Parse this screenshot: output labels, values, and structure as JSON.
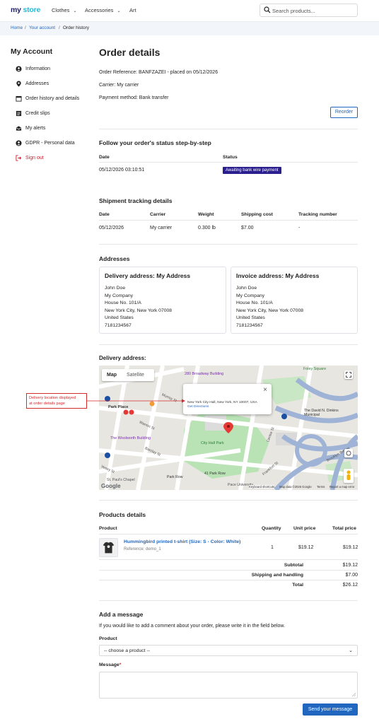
{
  "header": {
    "logo_main": "my",
    "logo_accent": "store",
    "nav": [
      "Clothes",
      "Accessories",
      "Art"
    ],
    "search_placeholder": "Search products..."
  },
  "breadcrumb": {
    "items": [
      "Home",
      "Your account",
      "Order history"
    ],
    "separator": "/"
  },
  "sidebar": {
    "title": "My Account",
    "items": [
      {
        "label": "Information",
        "icon": "person-icon"
      },
      {
        "label": "Addresses",
        "icon": "location-pin-icon"
      },
      {
        "label": "Order history and details",
        "icon": "calendar-icon"
      },
      {
        "label": "Credit slips",
        "icon": "document-icon"
      },
      {
        "label": "My alerts",
        "icon": "envelope-icon"
      },
      {
        "label": "GDPR - Personal data",
        "icon": "person-icon"
      },
      {
        "label": "Sign out",
        "icon": "sign-out-icon"
      }
    ]
  },
  "order": {
    "title": "Order details",
    "reference": "Order Reference: BANFZAZEI - placed on 05/12/2026",
    "carrier": "Carrier: My carrier",
    "payment": "Payment method: Bank transfer",
    "reorder_label": "Reorder"
  },
  "status": {
    "title": "Follow your order's status step-by-step",
    "headers": [
      "Date",
      "Status"
    ],
    "rows": [
      {
        "date": "05/12/2026 03:10:51",
        "status": "Awaiting bank wire payment"
      }
    ],
    "badge_color": "#2b1f8f"
  },
  "shipment": {
    "title": "Shipment tracking details",
    "headers": [
      "Date",
      "Carrier",
      "Weight",
      "Shipping cost",
      "Tracking number"
    ],
    "row": [
      "05/12/2026",
      "My carrier",
      "0.300 lb",
      "$7.00",
      "-"
    ]
  },
  "addresses": {
    "title": "Addresses",
    "delivery": {
      "title": "Delivery address: My Address",
      "lines": [
        "John Doe",
        "My Company",
        "House No. 101/A",
        "New York City, New York 07008",
        "United States",
        "7181234567"
      ]
    },
    "invoice": {
      "title": "Invoice address: My Address",
      "lines": [
        "John Doe",
        "My Company",
        "House No. 101/A",
        "New York City, New York 07008",
        "United States",
        "7181234567"
      ]
    }
  },
  "map": {
    "title": "Delivery address:",
    "tab_map": "Map",
    "tab_satellite": "Satellite",
    "popup_address": "New York City Hall, New York, NY 10007, USA",
    "popup_link": "Get Directions",
    "annotation_line1": "Delivery location displayed",
    "annotation_line2": "at order details page",
    "labels": {
      "broadway": "280 Broadway Building",
      "woolworth": "The Woolworth Building",
      "cityhall": "City Hall Park",
      "park_place": "Park Place",
      "foley": "Foley Square",
      "dinkins": "The David N. Dinkins Municipal",
      "park_row": "Park Row",
      "row41": "41 Park Row",
      "pauls": "St. Paul's Chapel",
      "pace": "Pace University",
      "murray": "Murray St",
      "warren": "Warren St",
      "barclay": "Barclay St",
      "vesey": "Vesey St",
      "frankfort": "Frankfort St",
      "centre": "Centre St",
      "brooklyn": "Brooklyn Bridge"
    },
    "footer": {
      "google": "Google",
      "shortcuts": "Keyboard shortcuts",
      "mapdata": "Map data ©2026 Google",
      "terms": "Terms",
      "report": "Report a map error"
    },
    "accent_color": "#d42a2a"
  },
  "products": {
    "title": "Products details",
    "headers": [
      "Product",
      "Quantity",
      "Unit price",
      "Total price"
    ],
    "item": {
      "name": "Hummingbird printed t-shirt (Size: S - Color: White)",
      "reference": "Reference: demo_1",
      "quantity": "1",
      "unit_price": "$19.12",
      "total_price": "$19.12"
    },
    "subtotal_label": "Subtotal",
    "subtotal": "$19.12",
    "shipping_label": "Shipping and handling",
    "shipping": "$7.00",
    "total_label": "Total",
    "total": "$26.12"
  },
  "message": {
    "title": "Add a message",
    "intro": "If you would like to add a comment about your order, please write it in the field below.",
    "product_label": "Product",
    "product_select": "-- choose a product --",
    "message_label": "Message",
    "required_mark": "*",
    "send_label": "Send your message"
  },
  "colors": {
    "link": "#2167c0",
    "accent": "#24b9d7",
    "danger": "#c6202f"
  }
}
